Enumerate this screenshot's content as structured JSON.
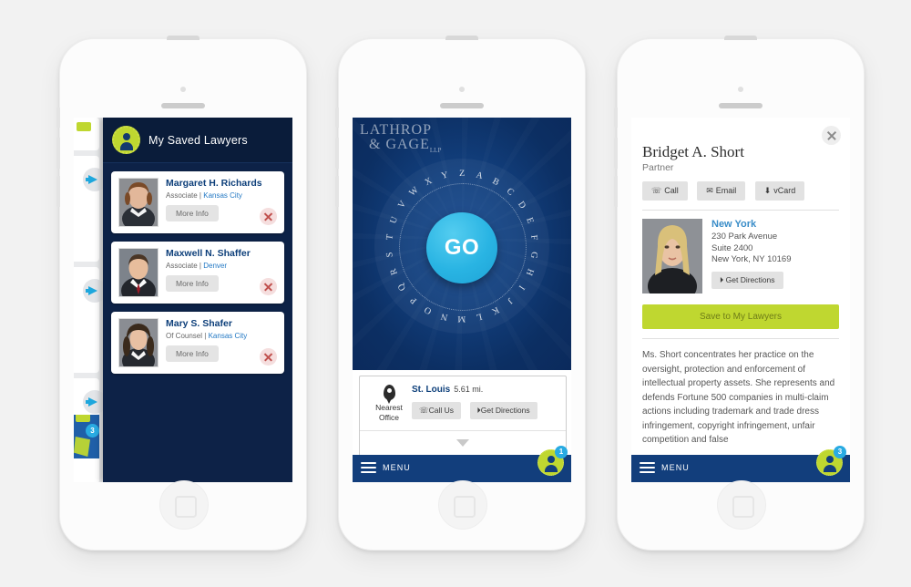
{
  "page": {
    "background": "#f2f2f2"
  },
  "phones": {
    "one": {
      "name": "saved-lawyers-phone",
      "header": {
        "title": "My Saved Lawyers",
        "avatar_icon": "person-avatar-icon"
      },
      "drawer": {
        "arrow_icon": "arrow-right-icon",
        "map_badge_count": "3"
      },
      "lawyers": [
        {
          "name": "Margaret H. Richards",
          "title": "Associate",
          "separator": "|",
          "city": "Kansas City",
          "button": "More Info",
          "remove_icon": "remove-x-icon"
        },
        {
          "name": "Maxwell N. Shaffer",
          "title": "Associate",
          "separator": "|",
          "city": "Denver",
          "button": "More Info",
          "remove_icon": "remove-x-icon"
        },
        {
          "name": "Mary S. Shafer",
          "title": "Of Counsel",
          "separator": "|",
          "city": "Kansas City",
          "button": "More Info",
          "remove_icon": "remove-x-icon"
        }
      ]
    },
    "two": {
      "name": "alphabet-dial-phone",
      "logo": {
        "line1": "LATHROP",
        "line2": "& GAGE",
        "suffix": "LLP"
      },
      "dial": {
        "go_label": "GO",
        "letters": [
          "A",
          "B",
          "C",
          "D",
          "E",
          "F",
          "G",
          "H",
          "I",
          "J",
          "K",
          "L",
          "M",
          "N",
          "O",
          "P",
          "Q",
          "R",
          "S",
          "T",
          "U",
          "V",
          "W",
          "X",
          "Y",
          "Z"
        ]
      },
      "nearest": {
        "pin_icon": "location-pin-icon",
        "label_line1": "Nearest",
        "label_line2": "Office",
        "office": "St. Louis",
        "distance": "5.61 mi.",
        "call_label": "Call Us",
        "call_icon": "phone-icon",
        "directions_label": "Get Directions",
        "directions_icon": "navigate-arrow-icon",
        "expand_icon": "chevron-down-icon"
      },
      "menubar": {
        "label": "MENU",
        "burger_icon": "hamburger-menu-icon",
        "badge_icon": "person-badge-icon",
        "badge_count": "1"
      }
    },
    "three": {
      "name": "lawyer-bio-phone",
      "close_icon": "close-x-icon",
      "name_text": "Bridget A. Short",
      "role": "Partner",
      "actions": [
        {
          "label": "Call",
          "icon": "phone-icon"
        },
        {
          "label": "Email",
          "icon": "envelope-icon"
        },
        {
          "label": "vCard",
          "icon": "download-arrow-icon"
        }
      ],
      "office": {
        "city": "New York",
        "address_line1": "230 Park Avenue",
        "address_line2": "Suite 2400",
        "address_line3": "New York, NY 10169",
        "directions_label": "Get Directions",
        "directions_icon": "navigate-arrow-icon",
        "photo_alt": "portrait-photo"
      },
      "save_label": "Save to My Lawyers",
      "bio": "Ms. Short concentrates her practice on the oversight, protection and enforcement of intellectual property assets. She represents and defends Fortune 500 companies in multi-claim actions including trademark and trade dress infringement, copyright infringement, unfair competition and false",
      "menubar": {
        "label": "MENU",
        "burger_icon": "hamburger-menu-icon",
        "badge_icon": "person-badge-icon",
        "badge_count": "3"
      }
    }
  },
  "colors": {
    "navy_dark": "#0d2247",
    "navy": "#123e7c",
    "accent_green": "#bfd730",
    "accent_cyan": "#29abe2",
    "link_blue": "#2479c4"
  }
}
